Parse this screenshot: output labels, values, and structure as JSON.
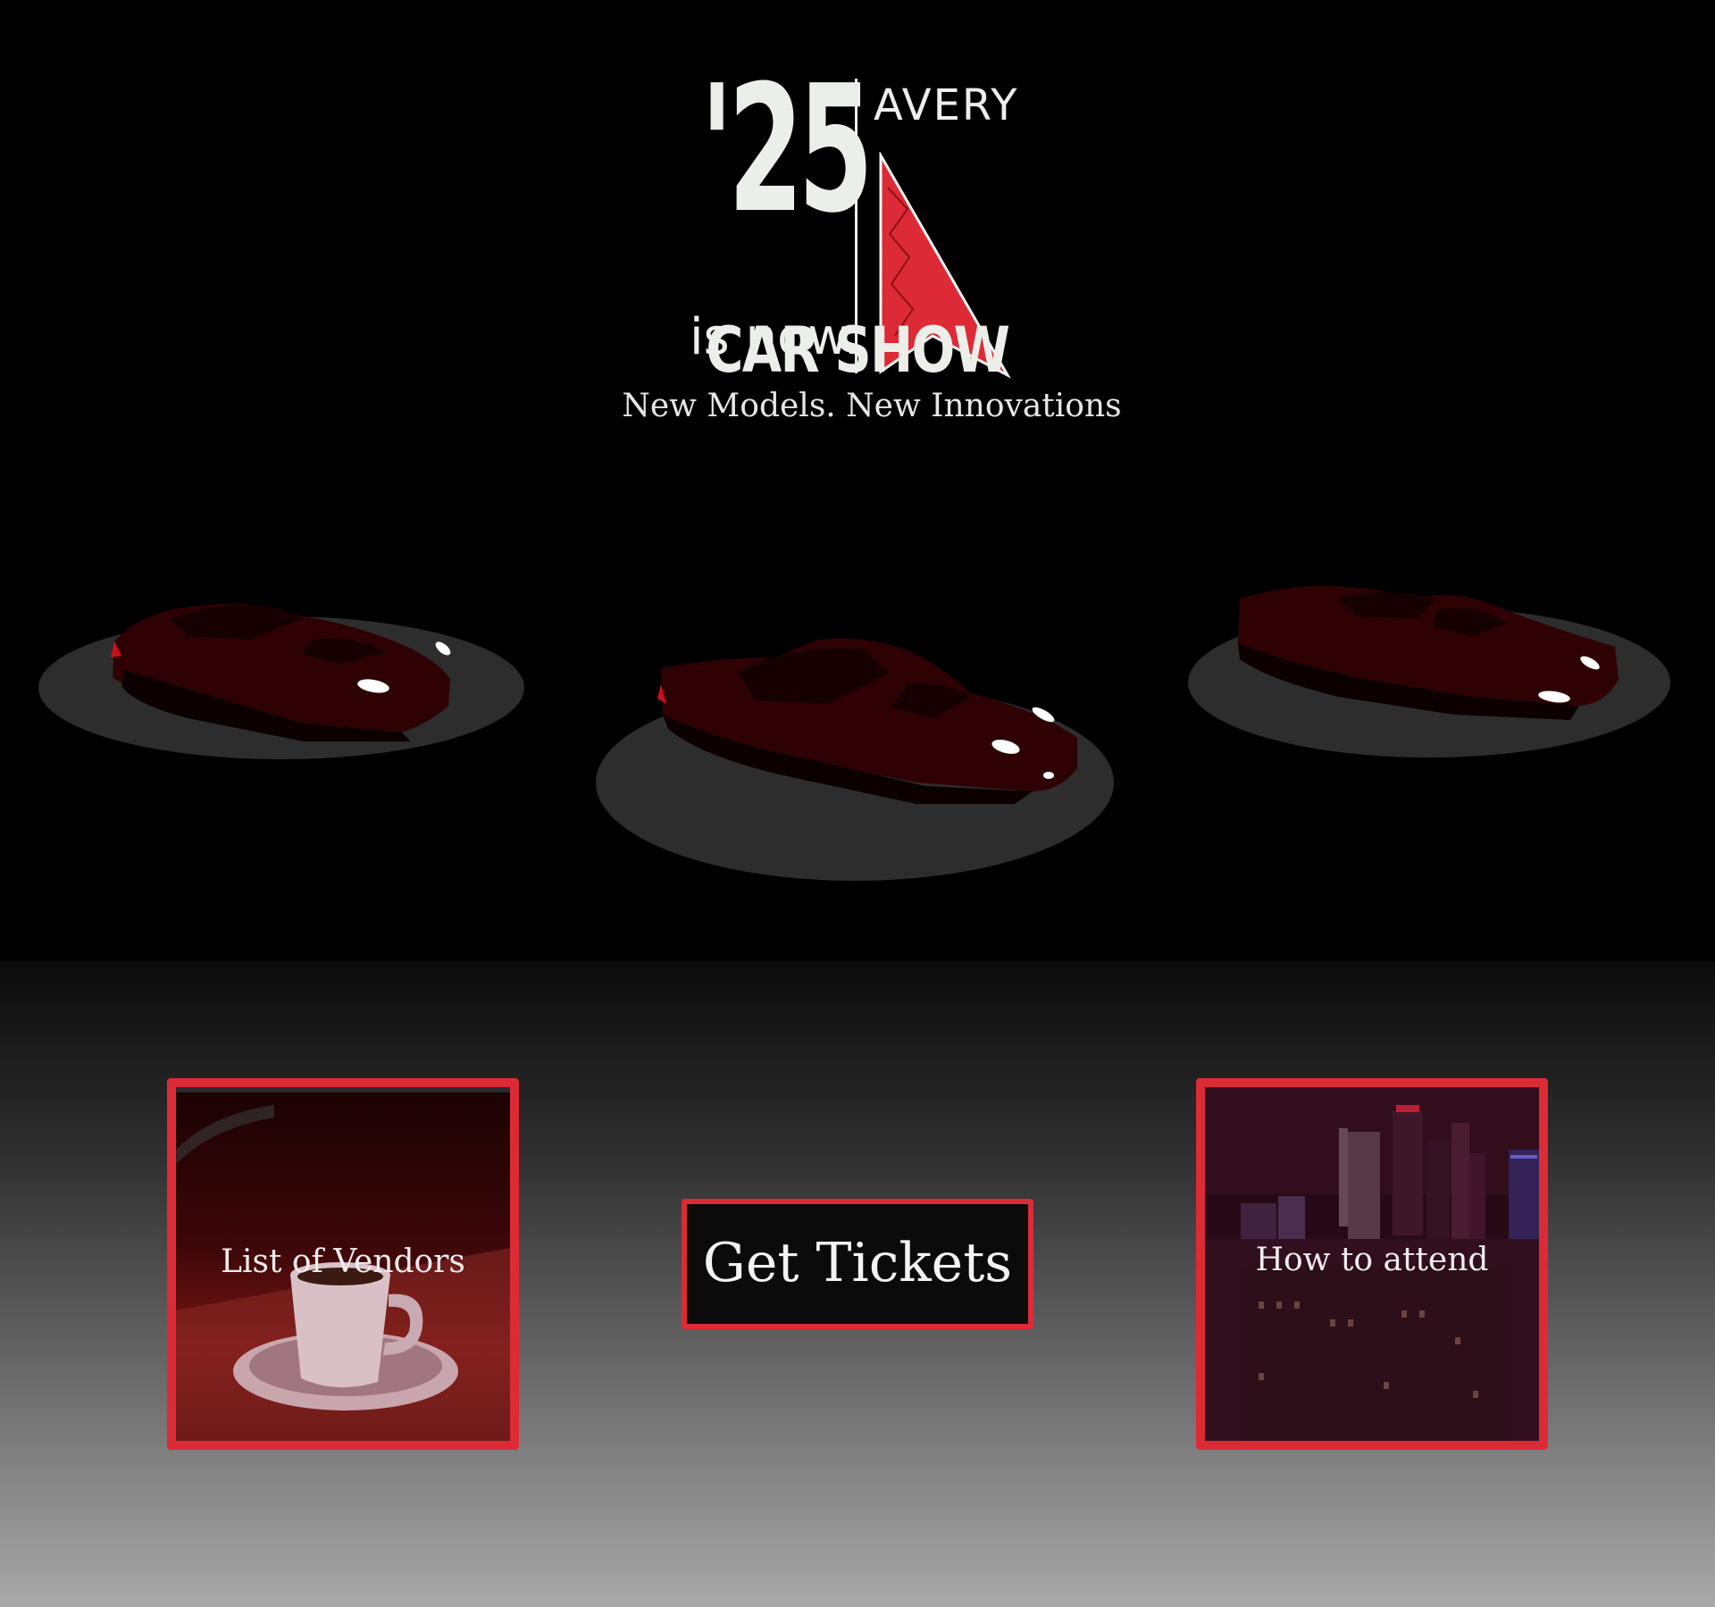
{
  "logo": {
    "year": "'25",
    "tagline": "is now.",
    "brand": "AVERY"
  },
  "hero": {
    "title": "CAR SHOW",
    "subtitle": "New Models. New Innovations"
  },
  "actions": {
    "vendors_label": "List of Vendors",
    "tickets_label": "Get Tickets",
    "attend_label": "How to attend"
  },
  "colors": {
    "accent": "#dc2b36",
    "text": "#eceeea",
    "car_body": "#3a0406",
    "platform": "#2d2d2d"
  }
}
